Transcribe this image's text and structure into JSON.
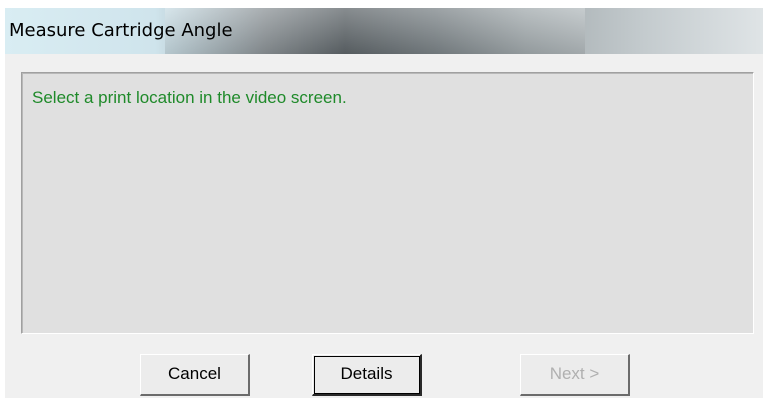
{
  "window": {
    "title": "Measure Cartridge Angle"
  },
  "message": {
    "text": "Select a print location in the video screen.",
    "color": "#1f8a2a"
  },
  "buttons": {
    "cancel_label": "Cancel",
    "details_label": "Details",
    "next_label": "Next >",
    "next_enabled": false
  }
}
